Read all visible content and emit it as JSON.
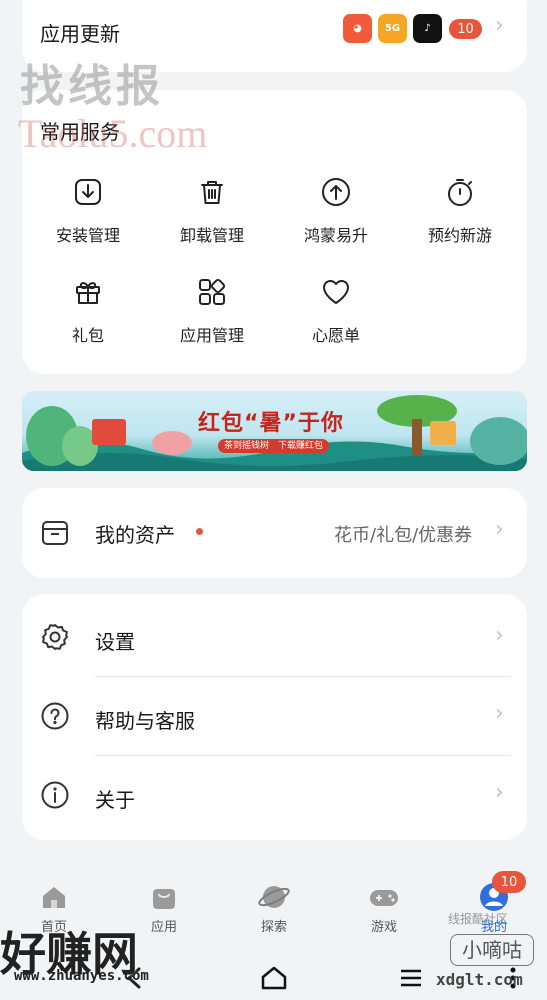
{
  "app_update": {
    "title": "应用更新",
    "badge_count": "10"
  },
  "services": {
    "title": "常用服务",
    "items": [
      {
        "label": "安装管理",
        "icon": "install-download-icon"
      },
      {
        "label": "卸载管理",
        "icon": "trash-icon"
      },
      {
        "label": "鸿蒙易升",
        "icon": "upgrade-arrow-icon"
      },
      {
        "label": "预约新游",
        "icon": "stopwatch-icon"
      },
      {
        "label": "礼包",
        "icon": "gift-icon"
      },
      {
        "label": "应用管理",
        "icon": "app-grid-icon"
      },
      {
        "label": "心愿单",
        "icon": "heart-icon"
      }
    ]
  },
  "banner": {
    "title": "红包“暑”于你",
    "subtitle": "茶到摇钱树　下载赚红包"
  },
  "assets": {
    "label": "我的资产",
    "right_text": "花币/礼包/优惠券"
  },
  "settings_list": [
    {
      "label": "设置",
      "icon": "gear-icon"
    },
    {
      "label": "帮助与客服",
      "icon": "help-icon"
    },
    {
      "label": "关于",
      "icon": "info-icon"
    }
  ],
  "bottom_nav": {
    "items": [
      {
        "label": "首页",
        "icon": "home-icon"
      },
      {
        "label": "应用",
        "icon": "shopping-bag-icon"
      },
      {
        "label": "探索",
        "icon": "planet-icon"
      },
      {
        "label": "游戏",
        "icon": "gamepad-icon"
      },
      {
        "label": "我的",
        "icon": "profile-icon"
      }
    ],
    "profile_badge": "10"
  },
  "watermarks": {
    "top_cn": "找线报",
    "top_en": "Taolu5.com",
    "bottom_left_cn": "好赚网",
    "bottom_left_en": "www.zhuanyes.com",
    "bottom_right_cn": "小嘀咕",
    "bottom_right_en": "xdglt.com",
    "mid_right": "线报酷社区"
  },
  "colors": {
    "accent_red": "#e8553a",
    "card_bg": "#ffffff",
    "page_bg": "#f1f3f5"
  }
}
